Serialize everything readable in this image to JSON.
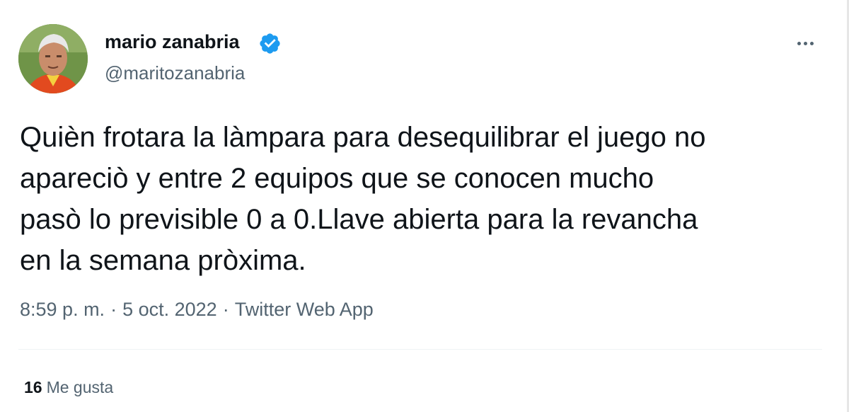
{
  "author": {
    "display_name": "mario zanabria",
    "handle": "@maritozanabria",
    "verified": true
  },
  "tweet": {
    "lines": [
      "Quièn frotara la làmpara para desequilibrar el juego no",
      "apareciò y entre 2 equipos que se conocen mucho",
      "pasò lo previsible 0 a 0.Llave abierta para la revancha",
      "en la semana pròxima."
    ]
  },
  "meta": {
    "time": "8:59 p. m.",
    "date": "5 oct. 2022",
    "source": "Twitter Web App",
    "separator": "·"
  },
  "stats": {
    "likes_count": "16",
    "likes_label": "Me gusta"
  },
  "icons": {
    "verified": "verified-badge-icon",
    "more": "more-options-icon"
  },
  "colors": {
    "verified_blue": "#1d9bf0",
    "text_primary": "#0f1419",
    "text_secondary": "#536471"
  }
}
